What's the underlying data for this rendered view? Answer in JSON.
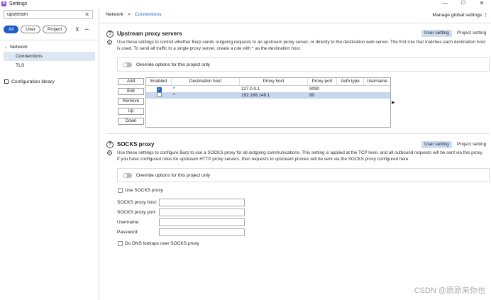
{
  "window": {
    "title": "Settings",
    "icon_letter": "S",
    "minimize": "—",
    "maximize": "☐",
    "close": "✕"
  },
  "sidebar": {
    "search_value": "upstream",
    "filters": [
      "All",
      "User",
      "Project"
    ],
    "tree": {
      "parent": "Network",
      "children": [
        "Connections",
        "TLS"
      ]
    },
    "config_library": "Configuration library"
  },
  "header": {
    "breadcrumb_root": "Network",
    "breadcrumb_sep": ">",
    "breadcrumb_current": "Connections",
    "global_settings": "Manage global settings"
  },
  "upstream": {
    "title": "Upstream proxy servers",
    "badge_user": "User setting",
    "badge_project": "Project setting",
    "description": "Use these settings to  control whether Burp sends outgoing requests to an upstream proxy server, or directly to the destination web server. The first rule that matches each destination host is used. To send all traffic to a single proxy server, create a rule with * as the destination host.",
    "override_label": "Override options for this project only",
    "buttons": [
      "Add",
      "Edit",
      "Remove",
      "Up",
      "Down"
    ],
    "columns": [
      "Enabled",
      "Destination host",
      "Proxy host",
      "Proxy port",
      "Auth type",
      "Username"
    ],
    "rows": [
      {
        "enabled": true,
        "dest": "*",
        "proxy_host": "127.0.0.1",
        "proxy_port": "9090",
        "auth": "",
        "user": ""
      },
      {
        "enabled": false,
        "dest": "*",
        "proxy_host": "192.168.149.1",
        "proxy_port": "80",
        "auth": "",
        "user": ""
      }
    ]
  },
  "socks": {
    "title": "SOCKS proxy",
    "badge_user": "User setting",
    "badge_project": "Project setting",
    "description": "Use these settings to configure Burp to use a SOCKS proxy for all outgoing communications. This setting is applied at the TCP level, and all outbound requests will be sent via this proxy. If you have configured rules for upstream HTTP proxy servers, then requests to upstream proxies will be sent via the SOCKS proxy configured here.",
    "override_label": "Override options for this project only",
    "use_socks": "Use SOCKS proxy",
    "fields": {
      "host": "SOCKS proxy host:",
      "port": "SOCKS proxy port:",
      "username": "Username:",
      "password": "Password:"
    },
    "dns_lookups": "Do DNS lookups over SOCKS proxy"
  },
  "watermark": "CSDN @原原来你也"
}
